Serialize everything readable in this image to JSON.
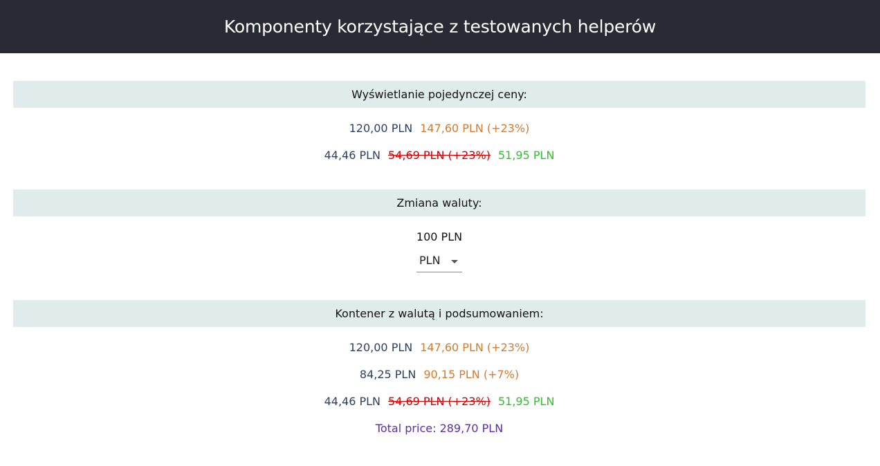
{
  "header": {
    "title": "Komponenty korzystające z testowanych helperów"
  },
  "single_price": {
    "title": "Wyświetlanie pojedynczej ceny:",
    "row1": {
      "net": "120,00 PLN",
      "gross": "147,60 PLN (+23%)"
    },
    "row2": {
      "net": "44,46 PLN",
      "old_gross": "54,69 PLN (+23%)",
      "promo": "51,95 PLN"
    }
  },
  "currency_change": {
    "title": "Zmiana waluty:",
    "amount": "100 PLN",
    "selected_currency": "PLN"
  },
  "container": {
    "title": "Kontener z walutą i podsumowaniem:",
    "row1": {
      "net": "120,00 PLN",
      "gross": "147,60 PLN (+23%)"
    },
    "row2": {
      "net": "84,25 PLN",
      "gross": "90,15 PLN (+7%)"
    },
    "row3": {
      "net": "44,46 PLN",
      "old_gross": "54,69 PLN (+23%)",
      "promo": "51,95 PLN"
    },
    "total": "Total price: 289,70 PLN"
  },
  "colors": {
    "header_bg": "#282b33",
    "section_bg": "#dfeceb",
    "net_price": "#2c3e60",
    "gross_price": "#d47a2f",
    "old_price": "#cc0000",
    "promo_price": "#2fbf2f",
    "total": "#5b2da6"
  }
}
